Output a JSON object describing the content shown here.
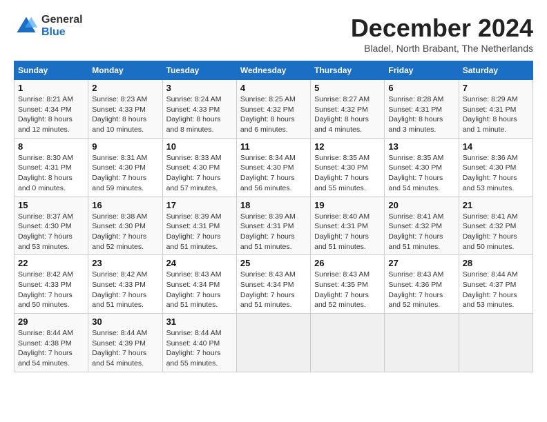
{
  "logo": {
    "general": "General",
    "blue": "Blue"
  },
  "title": "December 2024",
  "subtitle": "Bladel, North Brabant, The Netherlands",
  "days_of_week": [
    "Sunday",
    "Monday",
    "Tuesday",
    "Wednesday",
    "Thursday",
    "Friday",
    "Saturday"
  ],
  "weeks": [
    [
      {
        "day": 1,
        "sunrise": "8:21 AM",
        "sunset": "4:34 PM",
        "daylight": "8 hours and 12 minutes."
      },
      {
        "day": 2,
        "sunrise": "8:23 AM",
        "sunset": "4:33 PM",
        "daylight": "8 hours and 10 minutes."
      },
      {
        "day": 3,
        "sunrise": "8:24 AM",
        "sunset": "4:33 PM",
        "daylight": "8 hours and 8 minutes."
      },
      {
        "day": 4,
        "sunrise": "8:25 AM",
        "sunset": "4:32 PM",
        "daylight": "8 hours and 6 minutes."
      },
      {
        "day": 5,
        "sunrise": "8:27 AM",
        "sunset": "4:32 PM",
        "daylight": "8 hours and 4 minutes."
      },
      {
        "day": 6,
        "sunrise": "8:28 AM",
        "sunset": "4:31 PM",
        "daylight": "8 hours and 3 minutes."
      },
      {
        "day": 7,
        "sunrise": "8:29 AM",
        "sunset": "4:31 PM",
        "daylight": "8 hours and 1 minute."
      }
    ],
    [
      {
        "day": 8,
        "sunrise": "8:30 AM",
        "sunset": "4:31 PM",
        "daylight": "8 hours and 0 minutes."
      },
      {
        "day": 9,
        "sunrise": "8:31 AM",
        "sunset": "4:30 PM",
        "daylight": "7 hours and 59 minutes."
      },
      {
        "day": 10,
        "sunrise": "8:33 AM",
        "sunset": "4:30 PM",
        "daylight": "7 hours and 57 minutes."
      },
      {
        "day": 11,
        "sunrise": "8:34 AM",
        "sunset": "4:30 PM",
        "daylight": "7 hours and 56 minutes."
      },
      {
        "day": 12,
        "sunrise": "8:35 AM",
        "sunset": "4:30 PM",
        "daylight": "7 hours and 55 minutes."
      },
      {
        "day": 13,
        "sunrise": "8:35 AM",
        "sunset": "4:30 PM",
        "daylight": "7 hours and 54 minutes."
      },
      {
        "day": 14,
        "sunrise": "8:36 AM",
        "sunset": "4:30 PM",
        "daylight": "7 hours and 53 minutes."
      }
    ],
    [
      {
        "day": 15,
        "sunrise": "8:37 AM",
        "sunset": "4:30 PM",
        "daylight": "7 hours and 53 minutes."
      },
      {
        "day": 16,
        "sunrise": "8:38 AM",
        "sunset": "4:30 PM",
        "daylight": "7 hours and 52 minutes."
      },
      {
        "day": 17,
        "sunrise": "8:39 AM",
        "sunset": "4:31 PM",
        "daylight": "7 hours and 51 minutes."
      },
      {
        "day": 18,
        "sunrise": "8:39 AM",
        "sunset": "4:31 PM",
        "daylight": "7 hours and 51 minutes."
      },
      {
        "day": 19,
        "sunrise": "8:40 AM",
        "sunset": "4:31 PM",
        "daylight": "7 hours and 51 minutes."
      },
      {
        "day": 20,
        "sunrise": "8:41 AM",
        "sunset": "4:32 PM",
        "daylight": "7 hours and 51 minutes."
      },
      {
        "day": 21,
        "sunrise": "8:41 AM",
        "sunset": "4:32 PM",
        "daylight": "7 hours and 50 minutes."
      }
    ],
    [
      {
        "day": 22,
        "sunrise": "8:42 AM",
        "sunset": "4:33 PM",
        "daylight": "7 hours and 50 minutes."
      },
      {
        "day": 23,
        "sunrise": "8:42 AM",
        "sunset": "4:33 PM",
        "daylight": "7 hours and 51 minutes."
      },
      {
        "day": 24,
        "sunrise": "8:43 AM",
        "sunset": "4:34 PM",
        "daylight": "7 hours and 51 minutes."
      },
      {
        "day": 25,
        "sunrise": "8:43 AM",
        "sunset": "4:34 PM",
        "daylight": "7 hours and 51 minutes."
      },
      {
        "day": 26,
        "sunrise": "8:43 AM",
        "sunset": "4:35 PM",
        "daylight": "7 hours and 52 minutes."
      },
      {
        "day": 27,
        "sunrise": "8:43 AM",
        "sunset": "4:36 PM",
        "daylight": "7 hours and 52 minutes."
      },
      {
        "day": 28,
        "sunrise": "8:44 AM",
        "sunset": "4:37 PM",
        "daylight": "7 hours and 53 minutes."
      }
    ],
    [
      {
        "day": 29,
        "sunrise": "8:44 AM",
        "sunset": "4:38 PM",
        "daylight": "7 hours and 54 minutes."
      },
      {
        "day": 30,
        "sunrise": "8:44 AM",
        "sunset": "4:39 PM",
        "daylight": "7 hours and 54 minutes."
      },
      {
        "day": 31,
        "sunrise": "8:44 AM",
        "sunset": "4:40 PM",
        "daylight": "7 hours and 55 minutes."
      },
      null,
      null,
      null,
      null
    ]
  ]
}
